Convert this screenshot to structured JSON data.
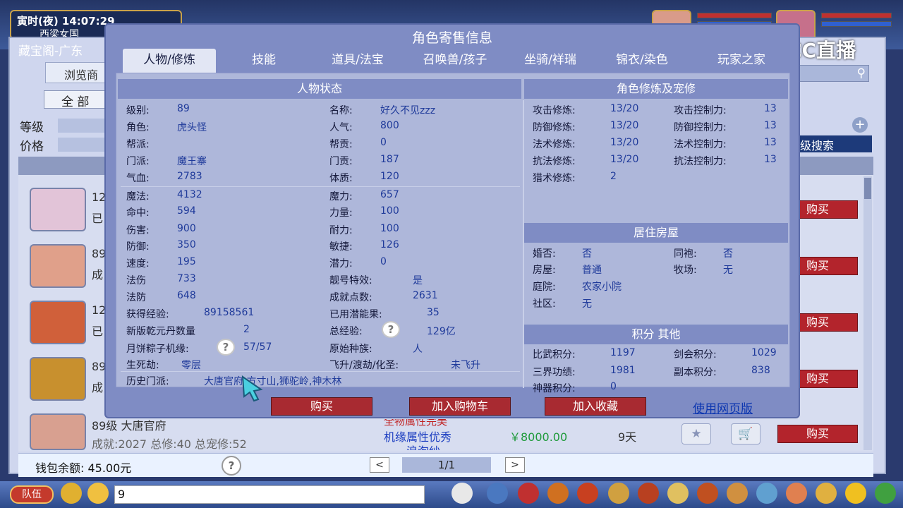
{
  "game": {
    "time_text": "寅时(夜) 14:07:29",
    "location_text": "西梁女国",
    "back_window_title": "藏宝阁-广东",
    "back_tab": "浏览商",
    "all_label": "全 部",
    "level_label": "等级",
    "price_label": "价格",
    "advanced_search": "级搜索",
    "wallet_text": "钱包余额: 45.00元",
    "pager_text": "1/1",
    "team_label": "队伍",
    "chat_value": "9",
    "last_row": {
      "title": "89级 大唐官府",
      "stats": "成就:2027 总修:40 总宠修:52",
      "desc_top": "全物属性完美",
      "desc_mid": "机缘属性优秀",
      "desc_bottom": "浪淘纱",
      "price": "￥8000.00",
      "days": "9天"
    },
    "buy_label": "购买",
    "row_numbers": [
      "12",
      "89",
      "12",
      "89"
    ],
    "row_status": [
      "已",
      "成",
      "已",
      "成"
    ]
  },
  "watermark": {
    "text": "CC直播"
  },
  "dialog": {
    "title": "角色寄售信息",
    "tabs": [
      "人物/修炼",
      "技能",
      "道具/法宝",
      "召唤兽/孩子",
      "坐骑/祥瑞",
      "锦衣/染色",
      "玩家之家"
    ],
    "status": {
      "header": "人物状态",
      "level_label": "级别:",
      "level": "89",
      "name_label": "名称:",
      "name": "好久不见zzz",
      "role_label": "角色:",
      "role": "虎头怪",
      "pop_label": "人气:",
      "pop": "800",
      "guild_label": "帮派:",
      "guild": "",
      "guild_contrib_label": "帮贡:",
      "guild_contrib": "0",
      "school_label": "门派:",
      "school": "魔王寨",
      "school_contrib_label": "门贡:",
      "school_contrib": "187",
      "hp_label": "气血:",
      "hp": "2783",
      "con_label": "体质:",
      "con": "120",
      "mp_label": "魔法:",
      "mp": "4132",
      "mag_label": "魔力:",
      "mag": "657",
      "hit_label": "命中:",
      "hit": "594",
      "str_label": "力量:",
      "str": "100",
      "dmg_label": "伤害:",
      "dmg": "900",
      "end_label": "耐力:",
      "end": "100",
      "def_label": "防御:",
      "def": "350",
      "agi_label": "敏捷:",
      "agi": "126",
      "spd_label": "速度:",
      "spd": "195",
      "pot_label": "潜力:",
      "pot": "0",
      "mdmg_label": "法伤",
      "mdmg": "733",
      "fx_label": "靓号特效:",
      "fx": "是",
      "mdef_label": "法防",
      "mdef": "648",
      "ach_label": "成就点数:",
      "ach": "2631",
      "exp_label": "获得经验:",
      "exp": "89158561",
      "fruit_label": "已用潜能果:",
      "fruit": "35",
      "qy_label": "新版乾元丹数量",
      "qy": "2",
      "total_exp_label": "总经验:",
      "total_exp": "129亿",
      "moon_label": "月饼粽子机缘:",
      "moon": "57/57",
      "race_label": "原始种族:",
      "race": "人",
      "life_label": "生死劫:",
      "life": "零层",
      "fly_label": "飞升/渡劫/化圣:",
      "fly": "未飞升",
      "hist_label": "历史门派:",
      "hist": "大唐官府,方寸山,狮驼岭,神木林"
    },
    "cultivation": {
      "header": "角色修炼及宠修",
      "atk_label": "攻击修炼:",
      "atk": "13/20",
      "atk_ctrl_label": "攻击控制力:",
      "atk_ctrl": "13",
      "dfs_label": "防御修炼:",
      "dfs": "13/20",
      "dfs_ctrl_label": "防御控制力:",
      "dfs_ctrl": "13",
      "spl_label": "法术修炼:",
      "spl": "13/20",
      "spl_ctrl_label": "法术控制力:",
      "spl_ctrl": "13",
      "res_label": "抗法修炼:",
      "res": "13/20",
      "res_ctrl_label": "抗法控制力:",
      "res_ctrl": "13",
      "hunt_label": "猎术修炼:",
      "hunt": "2"
    },
    "house": {
      "header": "居住房屋",
      "marry_label": "婚否:",
      "marry": "否",
      "robe_label": "同袍:",
      "robe": "否",
      "house_label": "房屋:",
      "house": "普通",
      "ranch_label": "牧场:",
      "ranch": "无",
      "yard_label": "庭院:",
      "yard": "农家小院",
      "comm_label": "社区:",
      "comm": "无"
    },
    "points": {
      "header": "积分 其他",
      "arena_label": "比武积分:",
      "arena": "1197",
      "sword_label": "剑会积分:",
      "sword": "1029",
      "merit_label": "三界功绩:",
      "merit": "1981",
      "dungeon_label": "副本积分:",
      "dungeon": "838",
      "artifact_label": "神器积分:",
      "artifact": "0"
    },
    "buttons": {
      "buy": "购买",
      "cart": "加入购物车",
      "fav": "加入收藏",
      "web": "使用网页版"
    }
  },
  "colors": {
    "dialog_bg": "#7f8cc4",
    "content_bg": "#aeb7da",
    "buy_red": "#a82a31",
    "value_blue": "#1f3a9a"
  }
}
